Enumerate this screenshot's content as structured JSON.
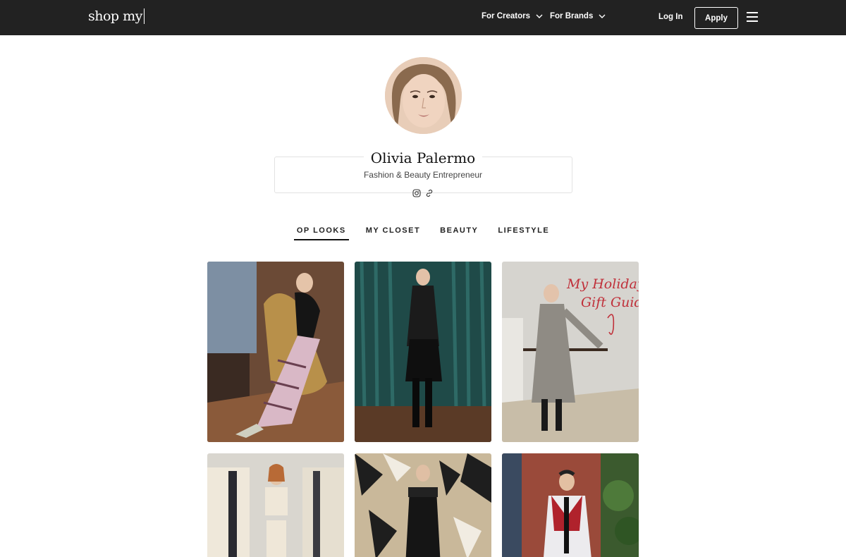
{
  "nav": {
    "logo": "shop my",
    "links": [
      {
        "label": "For Creators"
      },
      {
        "label": "For Brands"
      }
    ],
    "login": "Log In",
    "apply": "Apply"
  },
  "profile": {
    "name": "Olivia Palermo",
    "tagline": "Fashion & Beauty Entrepreneur",
    "socials": [
      "instagram-icon",
      "link-icon"
    ]
  },
  "tabs": [
    {
      "label": "OP LOOKS",
      "active": true
    },
    {
      "label": "MY CLOSET",
      "active": false
    },
    {
      "label": "BEAUTY",
      "active": false
    },
    {
      "label": "LIFESTYLE",
      "active": false
    }
  ],
  "looks": {
    "card3_overlay": [
      "My Holiday",
      "Gift Guide"
    ]
  },
  "colors": {
    "nav_bg": "#222222",
    "accent_red": "#c0303a"
  }
}
